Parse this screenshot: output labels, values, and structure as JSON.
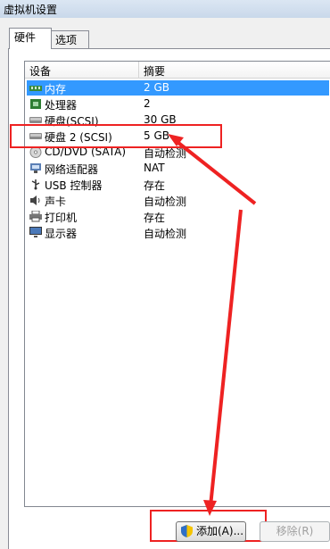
{
  "window": {
    "title": "虚拟机设置"
  },
  "tabs": [
    {
      "label": "硬件",
      "active": true
    },
    {
      "label": "选项",
      "active": false
    }
  ],
  "table": {
    "headers": {
      "device": "设备",
      "summary": "摘要"
    },
    "rows": [
      {
        "device": "内存",
        "summary": "2 GB",
        "icon": "memory-icon",
        "selected": true
      },
      {
        "device": "处理器",
        "summary": "2",
        "icon": "processor-icon"
      },
      {
        "device": "硬盘(SCSI)",
        "summary": "30 GB",
        "icon": "hard-disk-icon"
      },
      {
        "device": "硬盘 2 (SCSI)",
        "summary": "5 GB",
        "icon": "hard-disk-icon"
      },
      {
        "device": "CD/DVD (SATA)",
        "summary": "自动检测",
        "icon": "cd-dvd-icon"
      },
      {
        "device": "网络适配器",
        "summary": "NAT",
        "icon": "network-adapter-icon"
      },
      {
        "device": "USB 控制器",
        "summary": "存在",
        "icon": "usb-icon"
      },
      {
        "device": "声卡",
        "summary": "自动检测",
        "icon": "speaker-icon"
      },
      {
        "device": "打印机",
        "summary": "存在",
        "icon": "printer-icon"
      },
      {
        "device": "显示器",
        "summary": "自动检测",
        "icon": "monitor-icon"
      }
    ]
  },
  "buttons": {
    "add_label": "添加(A)...",
    "remove_label": "移除(R)"
  },
  "colors": {
    "selection": "#3399ff",
    "annotation": "#ee2222"
  }
}
